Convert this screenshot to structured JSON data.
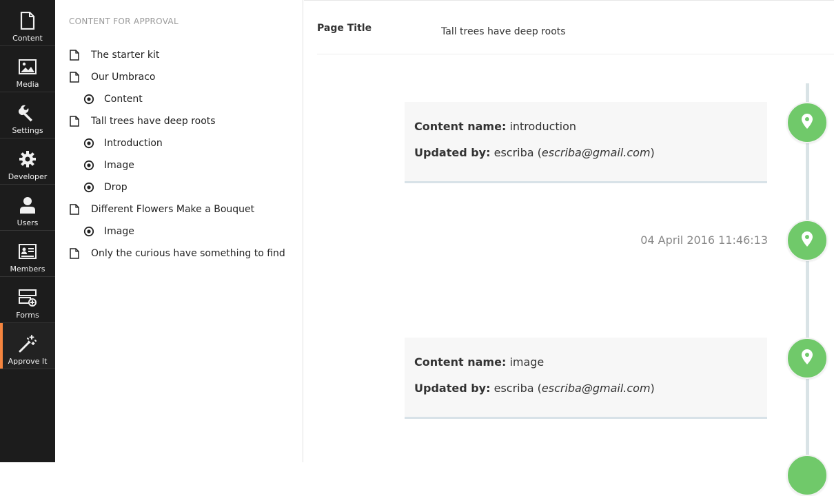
{
  "rail": {
    "items": [
      {
        "label": "Content",
        "icon": "document-icon"
      },
      {
        "label": "Media",
        "icon": "image-icon"
      },
      {
        "label": "Settings",
        "icon": "wrench-icon"
      },
      {
        "label": "Developer",
        "icon": "gear-icon"
      },
      {
        "label": "Users",
        "icon": "user-icon"
      },
      {
        "label": "Members",
        "icon": "id-card-icon"
      },
      {
        "label": "Forms",
        "icon": "forms-icon"
      },
      {
        "label": "Approve It",
        "icon": "magic-wand-icon",
        "active": true
      }
    ],
    "accent_color": "#f5853f"
  },
  "tree": {
    "title": "CONTENT FOR APPROVAL",
    "nodes": [
      {
        "label": "The starter kit",
        "level": 0,
        "icon": "document-icon"
      },
      {
        "label": "Our Umbraco",
        "level": 0,
        "icon": "document-icon"
      },
      {
        "label": "Content",
        "level": 1,
        "icon": "target-icon"
      },
      {
        "label": "Tall trees have deep roots",
        "level": 0,
        "icon": "document-icon"
      },
      {
        "label": "Introduction",
        "level": 1,
        "icon": "target-icon"
      },
      {
        "label": "Image",
        "level": 1,
        "icon": "target-icon"
      },
      {
        "label": "Drop",
        "level": 1,
        "icon": "target-icon"
      },
      {
        "label": "Different Flowers Make a Bouquet",
        "level": 0,
        "icon": "document-icon"
      },
      {
        "label": "Image",
        "level": 1,
        "icon": "target-icon"
      },
      {
        "label": "Only the curious have something to find",
        "level": 0,
        "icon": "document-icon"
      }
    ]
  },
  "main": {
    "page_title_label": "Page Title",
    "page_title_value": "Tall trees have deep roots",
    "timeline": {
      "pin_color": "#70c96a",
      "entries": [
        {
          "content_name_label": "Content name:",
          "content_name": "introduction",
          "updated_by_label": "Updated by:",
          "user": "escriba",
          "email": "escriba@gmail.com"
        },
        {
          "timestamp": "04 April 2016 11:46:13"
        },
        {
          "content_name_label": "Content name:",
          "content_name": "image",
          "updated_by_label": "Updated by:",
          "user": "escriba",
          "email": "escriba@gmail.com"
        }
      ]
    }
  }
}
